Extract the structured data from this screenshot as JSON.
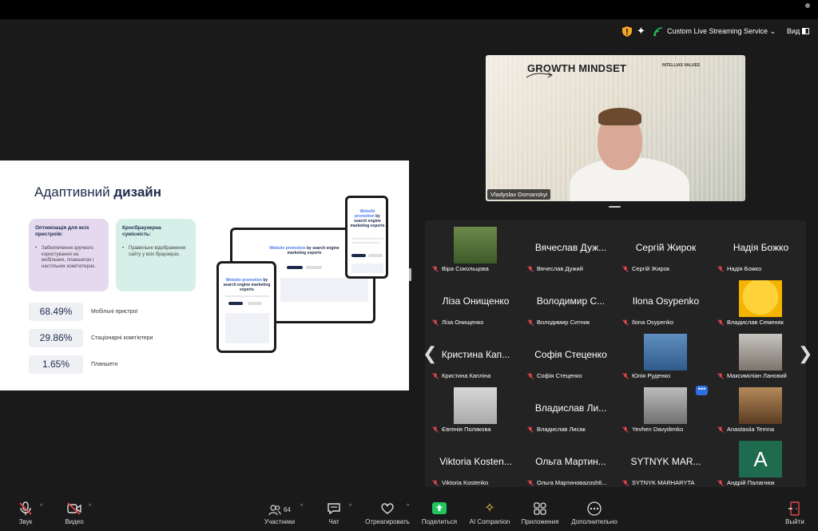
{
  "topbar": {
    "stream_label": "Custom Live Streaming Service",
    "view_label": "Вид"
  },
  "slide": {
    "title_light": "Адаптивний",
    "title_bold": "дизайн",
    "card1_title": "Оптимізація для всіх пристроїв:",
    "card1_text": "Забезпечення зручного користування на мобільних, планшетах і настільних комп'ютерах.",
    "card2_title": "Кросбраузерна сумісність:",
    "card2_text": "Правильне відображення сайту у всіх браузерах.",
    "stats": [
      {
        "value": "68.49%",
        "label": "Мобільні пристрої"
      },
      {
        "value": "29.86%",
        "label": "Стаціонарні комп'ютери"
      },
      {
        "value": "1.65%",
        "label": "Планшети"
      }
    ],
    "device_headline_accent": "Website promotion",
    "device_headline_rest": "by search engine marketing experts",
    "device_headline_accent_phone": "Website promotion",
    "device_headline_rest_phone": "by search engine marketing experts"
  },
  "speaker": {
    "title": "GROWTH MINDSET",
    "brand": "INTELLIAS VALUES",
    "name": "Vladyslav Domanskyi"
  },
  "participants": [
    {
      "big": "",
      "name": "Віра Сокольцова",
      "photo": true
    },
    {
      "big": "Вячеслав Дуж...",
      "name": "Вячеслав Дужий",
      "photo": false
    },
    {
      "big": "Сергій Жирок",
      "name": "Сергій Жирок",
      "photo": false
    },
    {
      "big": "Надія Божко",
      "name": "Надія Божко",
      "photo": false
    },
    {
      "big": "Ліза Онищенко",
      "name": "Ліза Онищенко",
      "photo": false
    },
    {
      "big": "Володимир С...",
      "name": "Володимир Ситник",
      "photo": false
    },
    {
      "big": "Ilona Osypenko",
      "name": "Ilona Osypenko",
      "photo": false
    },
    {
      "big": "",
      "name": "Владислав Семеняк",
      "photo": true
    },
    {
      "big": "Кристина Кап...",
      "name": "Кристина Капліна",
      "photo": false
    },
    {
      "big": "Софія Стеценко",
      "name": "Софія Стеценко",
      "photo": false
    },
    {
      "big": "",
      "name": "Юлія Руденко",
      "photo": true
    },
    {
      "big": "",
      "name": "Максиміліан Лановий",
      "photo": true
    },
    {
      "big": "",
      "name": "Євгенія Полякова",
      "photo": true
    },
    {
      "big": "Владислав Ли...",
      "name": "Владислав Лисак",
      "photo": false
    },
    {
      "big": "",
      "name": "Yevhen Davydenko",
      "photo": true
    },
    {
      "big": "",
      "name": "Anastasiia Temna",
      "photo": true
    },
    {
      "big": "Viktoria Kosten...",
      "name": "Viktoria Kostenko",
      "photo": false
    },
    {
      "big": "Ольга Мартин...",
      "name": "Ольга Мартиновazosh6...",
      "photo": false
    },
    {
      "big": "SYTNYK MAR...",
      "name": "SYTNYK MARHARYTA",
      "photo": false
    },
    {
      "big": "",
      "name": "Андрій Палагнюк",
      "photo": true,
      "initial": "A"
    }
  ],
  "more_label": "•••",
  "toolbar": {
    "audio": "Звук",
    "video": "Видео",
    "participants": "Участники",
    "participants_count": "64",
    "chat": "Чат",
    "react": "Отреагировать",
    "share": "Поделиться",
    "ai": "AI Companion",
    "apps": "Приложения",
    "more": "Дополнительно",
    "leave": "Выйти"
  },
  "colors": {
    "accent_green": "#22c55e",
    "leave_red": "#e5484d",
    "mute_red": "#e5484d"
  }
}
